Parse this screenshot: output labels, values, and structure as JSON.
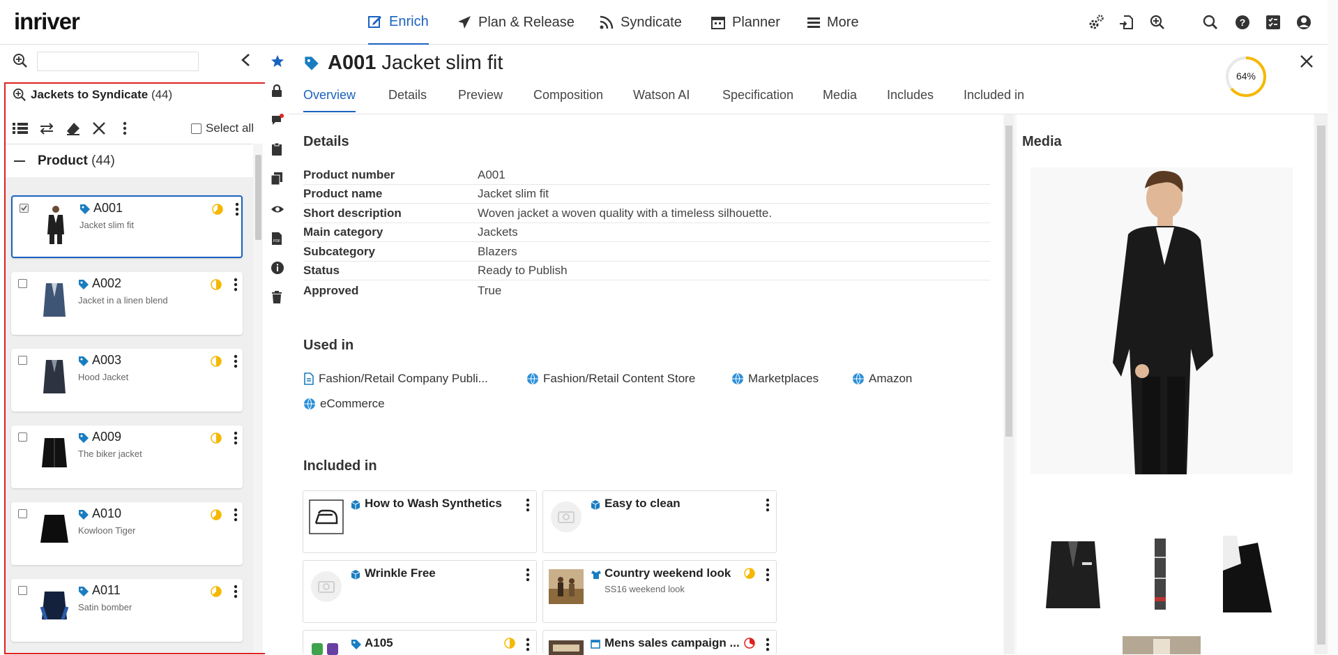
{
  "app": {
    "logo": "inriver"
  },
  "nav": [
    {
      "label": "Enrich",
      "icon": "edit-icon"
    },
    {
      "label": "Plan & Release",
      "icon": "paper-plane-icon"
    },
    {
      "label": "Syndicate",
      "icon": "rss-icon"
    },
    {
      "label": "Planner",
      "icon": "calendar-icon"
    },
    {
      "label": "More",
      "icon": "menu-icon"
    }
  ],
  "colors": {
    "accent": "#1a62c0",
    "highlight": "#e02020",
    "complete": "#f5b800",
    "tag": "#1a7dc0"
  },
  "left": {
    "search_placeholder": "",
    "query_title": "Jackets to Syndicate",
    "query_count": "(44)",
    "select_all": "Select all",
    "group_label": "Product",
    "group_count": "(44)",
    "items": [
      {
        "code": "A001",
        "desc": "Jacket slim fit",
        "selected": true
      },
      {
        "code": "A002",
        "desc": "Jacket in a linen blend",
        "selected": false
      },
      {
        "code": "A003",
        "desc": "Hood Jacket",
        "selected": false
      },
      {
        "code": "A009",
        "desc": "The biker jacket",
        "selected": false
      },
      {
        "code": "A010",
        "desc": "Kowloon Tiger",
        "selected": false
      },
      {
        "code": "A011",
        "desc": "Satin bomber",
        "selected": false
      }
    ]
  },
  "entity": {
    "code": "A001",
    "name": "Jacket slim fit",
    "completeness": "64%",
    "completeness_value": 0.64
  },
  "tabs": [
    "Overview",
    "Details",
    "Preview",
    "Composition",
    "Watson AI",
    "Specification",
    "Media",
    "Includes",
    "Included in"
  ],
  "details": {
    "title": "Details",
    "rows": [
      {
        "k": "Product number",
        "v": "A001"
      },
      {
        "k": "Product name",
        "v": "Jacket slim fit"
      },
      {
        "k": "Short description",
        "v": "Woven jacket a woven quality with a timeless silhouette."
      },
      {
        "k": "Main category",
        "v": "Jackets"
      },
      {
        "k": "Subcategory",
        "v": "Blazers"
      },
      {
        "k": "Status",
        "v": "Ready to Publish"
      },
      {
        "k": "Approved",
        "v": "True"
      }
    ]
  },
  "used_in": {
    "title": "Used in",
    "channels": [
      {
        "label": "Fashion/Retail Company Publi...",
        "icon": "document-icon"
      },
      {
        "label": "Fashion/Retail Content Store",
        "icon": "globe-icon"
      },
      {
        "label": "Marketplaces",
        "icon": "globe-icon"
      },
      {
        "label": "Amazon",
        "icon": "globe-icon"
      },
      {
        "label": "eCommerce",
        "icon": "globe-icon"
      }
    ]
  },
  "included_in": {
    "title": "Included in",
    "cards": [
      {
        "title": "How to Wash Synthetics",
        "sub": ""
      },
      {
        "title": "Easy to clean",
        "sub": ""
      },
      {
        "title": "Wrinkle Free",
        "sub": ""
      },
      {
        "title": "Country weekend look",
        "sub": "SS16 weekend look"
      },
      {
        "title": "A105",
        "sub": ""
      },
      {
        "title": "Mens sales campaign ...",
        "sub": ""
      }
    ]
  },
  "media": {
    "title": "Media"
  }
}
